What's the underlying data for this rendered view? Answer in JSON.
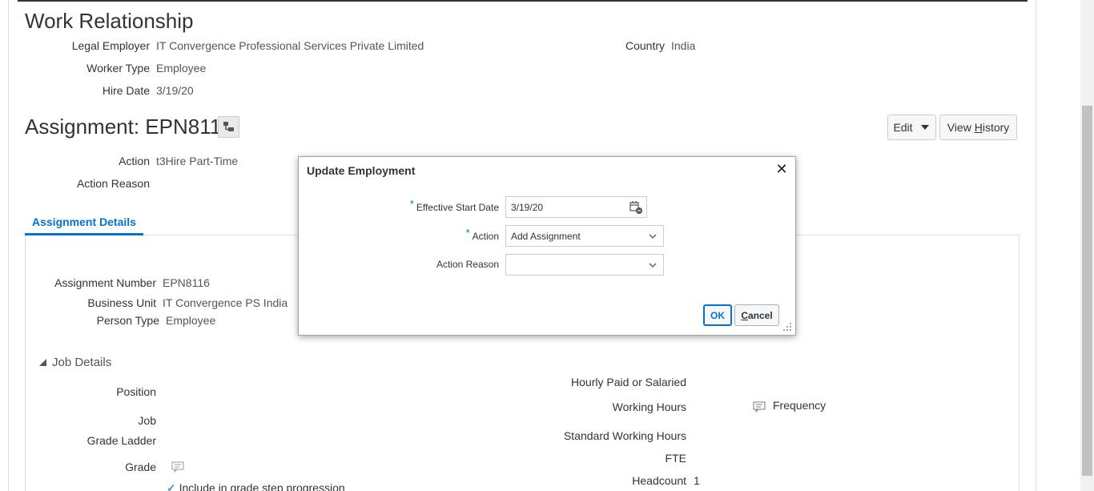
{
  "work_relationship": {
    "title": "Work Relationship",
    "legal_employer_label": "Legal Employer",
    "legal_employer_value": "IT Convergence Professional Services Private Limited",
    "country_label": "Country",
    "country_value": "India",
    "worker_type_label": "Worker Type",
    "worker_type_value": "Employee",
    "hire_date_label": "Hire Date",
    "hire_date_value": "3/19/20"
  },
  "assignment": {
    "title": "Assignment: EPN8116",
    "edit_label": "Edit",
    "view_history_label_pre": "View ",
    "view_history_label_ul": "H",
    "view_history_label_post": "istory",
    "action_label": "Action",
    "action_value": "t3Hire Part-Time",
    "action_reason_label": "Action Reason",
    "tab_label": "Assignment Details",
    "assignment_number_label": "Assignment Number",
    "assignment_number_value": "EPN8116",
    "business_unit_label": "Business Unit",
    "business_unit_value": "IT Convergence PS India",
    "person_type_label": "Person Type",
    "person_type_value": "Employee"
  },
  "job_details": {
    "section_title": "Job Details",
    "position_label": "Position",
    "job_label": "Job",
    "grade_ladder_label": "Grade Ladder",
    "grade_label": "Grade",
    "include_grade_step_label": "Include in grade step progression",
    "hourly_paid_label": "Hourly Paid or Salaried",
    "working_hours_label": "Working Hours",
    "frequency_label": "Frequency",
    "standard_working_hours_label": "Standard Working Hours",
    "fte_label": "FTE",
    "headcount_label": "Headcount",
    "headcount_value": "1"
  },
  "dialog": {
    "title": "Update Employment",
    "effective_start_date_label": "Effective Start Date",
    "effective_start_date_value": "3/19/20",
    "action_label": "Action",
    "action_value": "Add Assignment",
    "action_reason_label": "Action Reason",
    "action_reason_value": "",
    "ok_label": "OK",
    "cancel_label_ul": "C",
    "cancel_label_rest": "ancel",
    "required_marker": "*"
  },
  "colors": {
    "accent": "#0572ce",
    "text": "#333333",
    "muted": "#555555",
    "border": "#c4ced7"
  }
}
